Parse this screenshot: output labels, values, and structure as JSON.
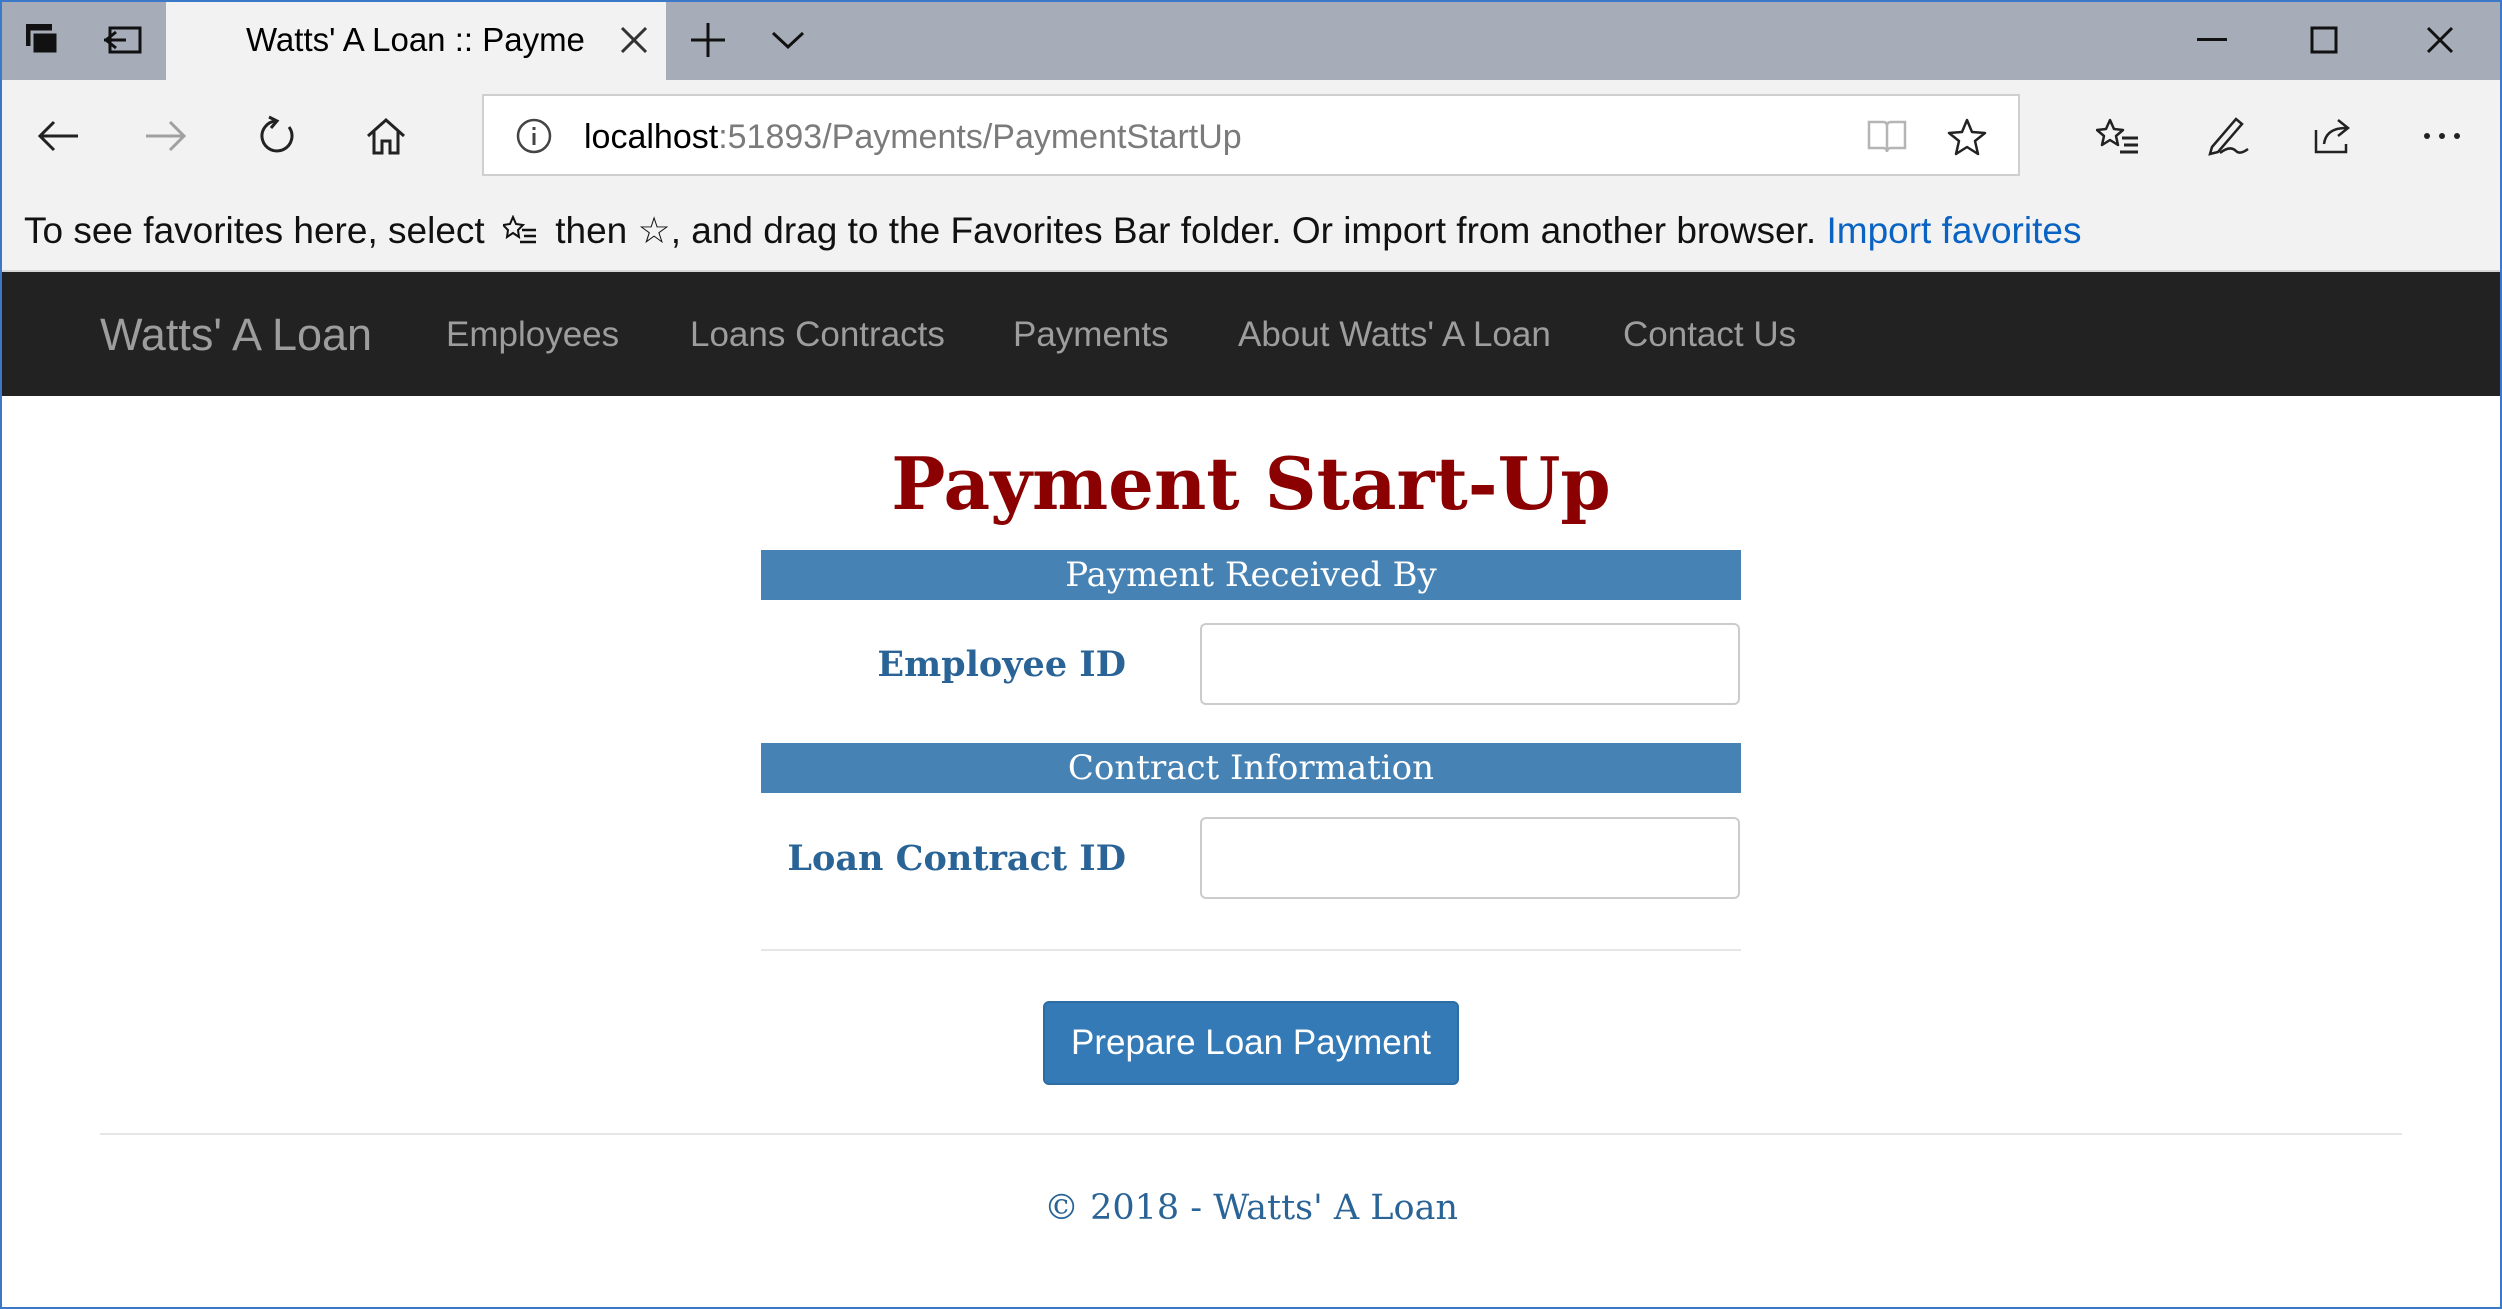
{
  "browser": {
    "tab_title": "Watts' A Loan :: Paymen",
    "url_host": "localhost",
    "url_path": ":51893/Payments/PaymentStartUp",
    "favorites_message_before": "To see favorites here, select",
    "favorites_message_then": "then ☆, and drag to the Favorites Bar folder. Or import from another browser.",
    "import_link": "Import favorites",
    "icons": [
      "tab-manager-icon",
      "set-aside-tabs-icon",
      "close-tab-icon",
      "new-tab-icon",
      "tab-preview-chevron-icon",
      "minimize-icon",
      "maximize-icon",
      "close-window-icon",
      "back-icon",
      "forward-icon",
      "refresh-icon",
      "home-icon",
      "info-icon",
      "reading-view-icon",
      "favorite-star-icon",
      "favorites-hub-icon",
      "pen-icon",
      "share-icon",
      "more-icon"
    ]
  },
  "site": {
    "brand": "Watts' A Loan",
    "nav": [
      "Employees",
      "Loans Contracts",
      "Payments",
      "About Watts' A Loan",
      "Contact Us"
    ]
  },
  "page": {
    "title": "Payment Start-Up",
    "section1": "Payment Received By",
    "employee_label": "Employee ID",
    "employee_value": "",
    "section2": "Contract Information",
    "loan_label": "Loan Contract ID",
    "loan_value": "",
    "submit": "Prepare Loan Payment",
    "footer": "© 2018 - Watts' A Loan"
  },
  "colors": {
    "heading": "#8b0000",
    "section_bar": "#4682b4",
    "label": "#2a6496",
    "button": "#337ab7",
    "navbar": "#222222",
    "link": "#0a63c2"
  }
}
